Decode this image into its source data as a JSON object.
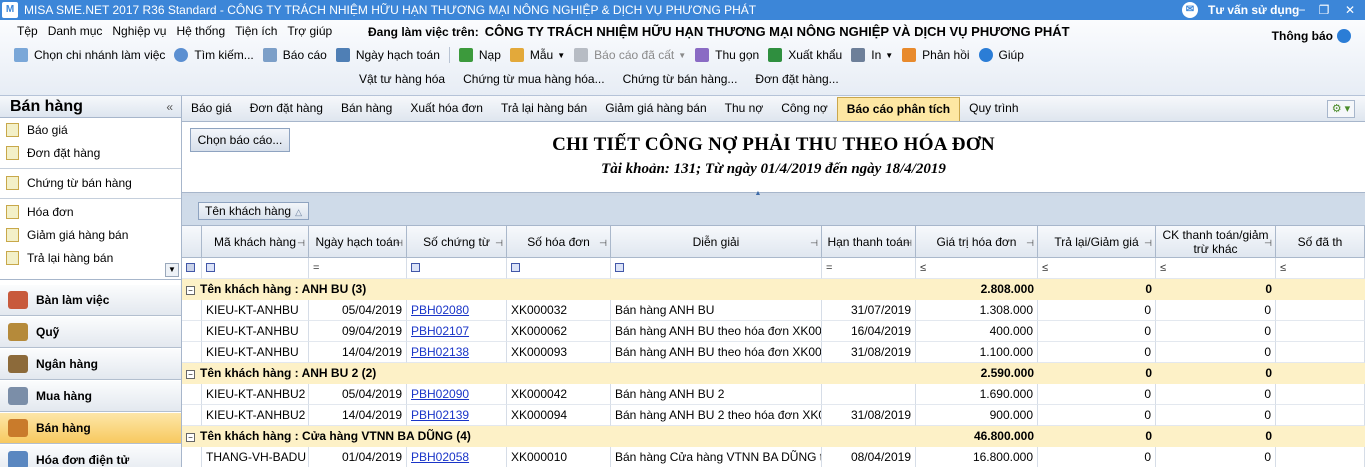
{
  "window": {
    "title": "MISA SME.NET 2017 R36 Standard - CÔNG TY TRÁCH NHIỆM HỮU HẠN THƯƠNG MẠI NÔNG NGHIỆP & DỊCH VỤ PHƯƠNG PHÁT",
    "help_label": "Tư vấn sử dụng",
    "min": "−",
    "restore": "❐",
    "close": "✕"
  },
  "menu": {
    "items": [
      "Tệp",
      "Danh mục",
      "Nghiệp vụ",
      "Hệ thống",
      "Tiện ích",
      "Trợ giúp"
    ],
    "working_label": "Đang làm việc trên:",
    "company": "CÔNG TY TRÁCH NHIỆM HỮU HẠN THƯƠNG MẠI NÔNG NGHIỆP VÀ DỊCH VỤ PHƯƠNG PHÁT",
    "notice": "Thông báo"
  },
  "toolbar": {
    "branch": "Chọn chi nhánh làm việc",
    "search": "Tìm kiếm...",
    "report": "Báo cáo",
    "date": "Ngày hạch toán",
    "load": "Nạp",
    "template": "Mẫu",
    "saved_report": "Báo cáo đã cất",
    "collapse": "Thu gọn",
    "export": "Xuất khẩu",
    "print": "In",
    "feedback": "Phản hồi",
    "help": "Giúp"
  },
  "subtoolbar": [
    "Vật tư hàng hóa",
    "Chứng từ mua hàng hóa...",
    "Chứng từ bán hàng...",
    "Đơn đặt hàng..."
  ],
  "leftnav": {
    "title": "Bán hàng",
    "collapse": "«",
    "items": [
      "Báo giá",
      "Đơn đặt hàng",
      "Chứng từ bán hàng",
      "Hóa đơn",
      "Giảm giá hàng bán",
      "Trả lại hàng bán"
    ],
    "modules": [
      "Bàn làm việc",
      "Quỹ",
      "Ngân hàng",
      "Mua hàng",
      "Bán hàng",
      "Hóa đơn điện tử"
    ],
    "active_module": "Bán hàng"
  },
  "tabs": [
    "Báo giá",
    "Đơn đặt hàng",
    "Bán hàng",
    "Xuất hóa đơn",
    "Trả lại hàng bán",
    "Giảm giá hàng bán",
    "Thu nợ",
    "Công nợ",
    "Báo cáo phân tích",
    "Quy trình"
  ],
  "active_tab": "Báo cáo phân tích",
  "report": {
    "choose_button": "Chọn báo cáo...",
    "title": "CHI TIẾT CÔNG NỢ PHẢI THU THEO HÓA ĐƠN",
    "subtitle": "Tài khoản: 131; Từ ngày 01/4/2019 đến ngày 18/4/2019",
    "group_by": "Tên khách hàng"
  },
  "grid": {
    "columns": [
      "Mã khách hàng",
      "Ngày hạch toán",
      "Số chứng từ",
      "Số hóa đơn",
      "Diễn giải",
      "Hạn thanh toán",
      "Giá trị hóa đơn",
      "Trả lại/Giảm giá",
      "CK thanh toán/giảm trừ khác",
      "Số đã th"
    ],
    "filter_ops": [
      "",
      "=",
      "",
      "",
      "",
      "=",
      "≤",
      "≤",
      "≤",
      "≤"
    ],
    "groups": [
      {
        "label": "Tên khách hàng : ANH BU (3)",
        "total": "2.808.000",
        "ret": "0",
        "ck": "0",
        "rows": [
          {
            "code": "KIEU-KT-ANHBU",
            "date": "05/04/2019",
            "doc": "PBH02080",
            "inv": "XK000032",
            "desc": "Bán hàng ANH BU",
            "due": "31/07/2019",
            "value": "1.308.000",
            "ret": "0",
            "ck": "0"
          },
          {
            "code": "KIEU-KT-ANHBU",
            "date": "09/04/2019",
            "doc": "PBH02107",
            "inv": "XK000062",
            "desc": "Bán hàng ANH BU theo hóa đơn XK000",
            "due": "16/04/2019",
            "value": "400.000",
            "ret": "0",
            "ck": "0"
          },
          {
            "code": "KIEU-KT-ANHBU",
            "date": "14/04/2019",
            "doc": "PBH02138",
            "inv": "XK000093",
            "desc": "Bán hàng ANH BU theo hóa đơn XK000",
            "due": "31/08/2019",
            "value": "1.100.000",
            "ret": "0",
            "ck": "0"
          }
        ]
      },
      {
        "label": "Tên khách hàng : ANH BU 2 (2)",
        "total": "2.590.000",
        "ret": "0",
        "ck": "0",
        "rows": [
          {
            "code": "KIEU-KT-ANHBU2",
            "date": "05/04/2019",
            "doc": "PBH02090",
            "inv": "XK000042",
            "desc": "Bán hàng ANH BU 2",
            "due": "",
            "value": "1.690.000",
            "ret": "0",
            "ck": "0"
          },
          {
            "code": "KIEU-KT-ANHBU2",
            "date": "14/04/2019",
            "doc": "PBH02139",
            "inv": "XK000094",
            "desc": "Bán hàng ANH BU 2 theo hóa đơn XK0",
            "due": "31/08/2019",
            "value": "900.000",
            "ret": "0",
            "ck": "0"
          }
        ]
      },
      {
        "label": "Tên khách hàng : Cửa hàng VTNN BA DŨNG (4)",
        "total": "46.800.000",
        "ret": "0",
        "ck": "0",
        "rows": [
          {
            "code": "THANG-VH-BADU",
            "date": "01/04/2019",
            "doc": "PBH02058",
            "inv": "XK000010",
            "desc": "Bán hàng Cửa hàng VTNN BA DŨNG t",
            "due": "08/04/2019",
            "value": "16.800.000",
            "ret": "0",
            "ck": "0"
          }
        ]
      }
    ]
  }
}
